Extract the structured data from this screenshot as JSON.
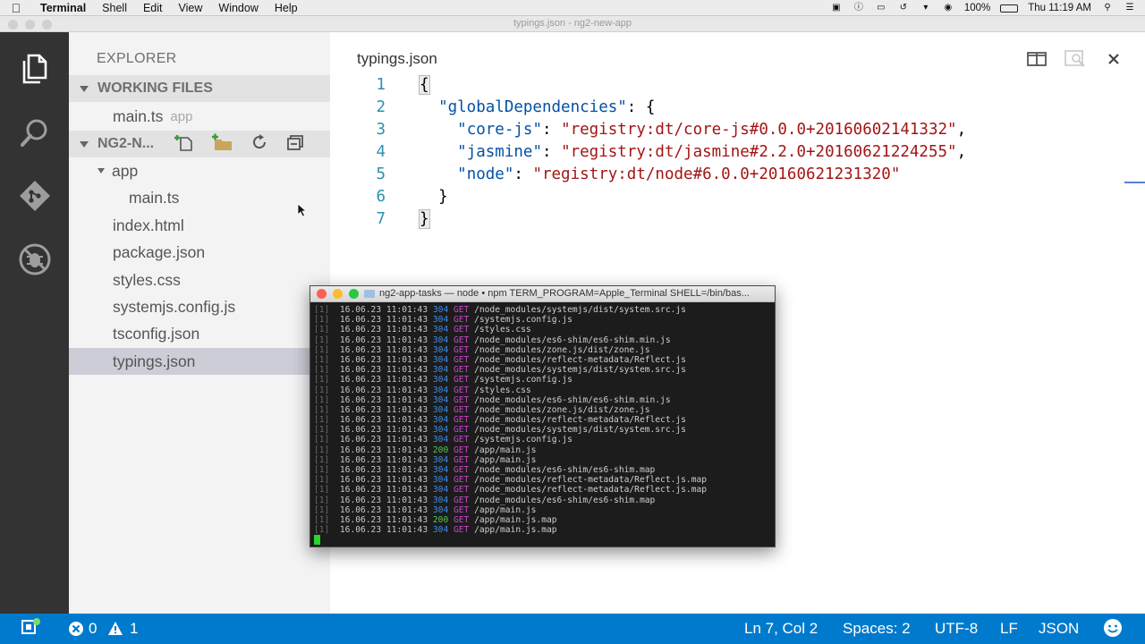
{
  "menubar": {
    "app_name": "Terminal",
    "items": [
      "Shell",
      "Edit",
      "View",
      "Window",
      "Help"
    ],
    "battery": "100%",
    "clock": "Thu 11:19 AM"
  },
  "window": {
    "title": "typings.json - ng2-new-app"
  },
  "sidebar": {
    "header": "EXPLORER",
    "working_files": {
      "label": "WORKING FILES",
      "items": [
        {
          "name": "main.ts",
          "hint": "app"
        }
      ]
    },
    "project": {
      "label": "NG2-N...",
      "folder": "app",
      "folder_child": "main.ts",
      "files": [
        "index.html",
        "package.json",
        "styles.css",
        "systemjs.config.js",
        "tsconfig.json",
        "typings.json"
      ]
    }
  },
  "editor": {
    "tab_title": "typings.json",
    "lines": [
      {
        "n": "1",
        "indent": "",
        "key": "",
        "value": "",
        "punct": "{",
        "boxed": true
      },
      {
        "n": "2",
        "indent": "  ",
        "key": "\"globalDependencies\"",
        "value": "",
        "punct": ": {"
      },
      {
        "n": "3",
        "indent": "    ",
        "key": "\"core-js\"",
        "value": "\"registry:dt/core-js#0.0.0+20160602141332\"",
        "punct": ","
      },
      {
        "n": "4",
        "indent": "    ",
        "key": "\"jasmine\"",
        "value": "\"registry:dt/jasmine#2.2.0+20160621224255\"",
        "punct": ","
      },
      {
        "n": "5",
        "indent": "    ",
        "key": "\"node\"",
        "value": "\"registry:dt/node#6.0.0+20160621231320\"",
        "punct": ""
      },
      {
        "n": "6",
        "indent": "  ",
        "key": "",
        "value": "",
        "punct": "}"
      },
      {
        "n": "7",
        "indent": "",
        "key": "",
        "value": "",
        "punct": "}",
        "boxed": true
      }
    ]
  },
  "terminal": {
    "title": "ng2-app-tasks — node • npm TERM_PROGRAM=Apple_Terminal SHELL=/bin/bas...",
    "prefix": "[1]",
    "log": [
      {
        "date": "16.06.23",
        "time": "11:01:43",
        "code": "304",
        "method": "GET",
        "path": "/node_modules/systemjs/dist/system.src.js"
      },
      {
        "date": "16.06.23",
        "time": "11:01:43",
        "code": "304",
        "method": "GET",
        "path": "/systemjs.config.js"
      },
      {
        "date": "16.06.23",
        "time": "11:01:43",
        "code": "304",
        "method": "GET",
        "path": "/styles.css"
      },
      {
        "date": "16.06.23",
        "time": "11:01:43",
        "code": "304",
        "method": "GET",
        "path": "/node_modules/es6-shim/es6-shim.min.js"
      },
      {
        "date": "16.06.23",
        "time": "11:01:43",
        "code": "304",
        "method": "GET",
        "path": "/node_modules/zone.js/dist/zone.js"
      },
      {
        "date": "16.06.23",
        "time": "11:01:43",
        "code": "304",
        "method": "GET",
        "path": "/node_modules/reflect-metadata/Reflect.js"
      },
      {
        "date": "16.06.23",
        "time": "11:01:43",
        "code": "304",
        "method": "GET",
        "path": "/node_modules/systemjs/dist/system.src.js"
      },
      {
        "date": "16.06.23",
        "time": "11:01:43",
        "code": "304",
        "method": "GET",
        "path": "/systemjs.config.js"
      },
      {
        "date": "16.06.23",
        "time": "11:01:43",
        "code": "304",
        "method": "GET",
        "path": "/styles.css"
      },
      {
        "date": "16.06.23",
        "time": "11:01:43",
        "code": "304",
        "method": "GET",
        "path": "/node_modules/es6-shim/es6-shim.min.js"
      },
      {
        "date": "16.06.23",
        "time": "11:01:43",
        "code": "304",
        "method": "GET",
        "path": "/node_modules/zone.js/dist/zone.js"
      },
      {
        "date": "16.06.23",
        "time": "11:01:43",
        "code": "304",
        "method": "GET",
        "path": "/node_modules/reflect-metadata/Reflect.js"
      },
      {
        "date": "16.06.23",
        "time": "11:01:43",
        "code": "304",
        "method": "GET",
        "path": "/node_modules/systemjs/dist/system.src.js"
      },
      {
        "date": "16.06.23",
        "time": "11:01:43",
        "code": "304",
        "method": "GET",
        "path": "/systemjs.config.js"
      },
      {
        "date": "16.06.23",
        "time": "11:01:43",
        "code": "200",
        "method": "GET",
        "path": "/app/main.js"
      },
      {
        "date": "16.06.23",
        "time": "11:01:43",
        "code": "304",
        "method": "GET",
        "path": "/app/main.js"
      },
      {
        "date": "16.06.23",
        "time": "11:01:43",
        "code": "304",
        "method": "GET",
        "path": "/node_modules/es6-shim/es6-shim.map"
      },
      {
        "date": "16.06.23",
        "time": "11:01:43",
        "code": "304",
        "method": "GET",
        "path": "/node_modules/reflect-metadata/Reflect.js.map"
      },
      {
        "date": "16.06.23",
        "time": "11:01:43",
        "code": "304",
        "method": "GET",
        "path": "/node_modules/reflect-metadata/Reflect.js.map"
      },
      {
        "date": "16.06.23",
        "time": "11:01:43",
        "code": "304",
        "method": "GET",
        "path": "/node_modules/es6-shim/es6-shim.map"
      },
      {
        "date": "16.06.23",
        "time": "11:01:43",
        "code": "304",
        "method": "GET",
        "path": "/app/main.js"
      },
      {
        "date": "16.06.23",
        "time": "11:01:43",
        "code": "200",
        "method": "GET",
        "path": "/app/main.js.map"
      },
      {
        "date": "16.06.23",
        "time": "11:01:43",
        "code": "304",
        "method": "GET",
        "path": "/app/main.js.map"
      }
    ]
  },
  "statusbar": {
    "errors": "0",
    "warnings": "1",
    "position": "Ln 7, Col 2",
    "spaces": "Spaces: 2",
    "encoding": "UTF-8",
    "eol": "LF",
    "language": "JSON"
  }
}
